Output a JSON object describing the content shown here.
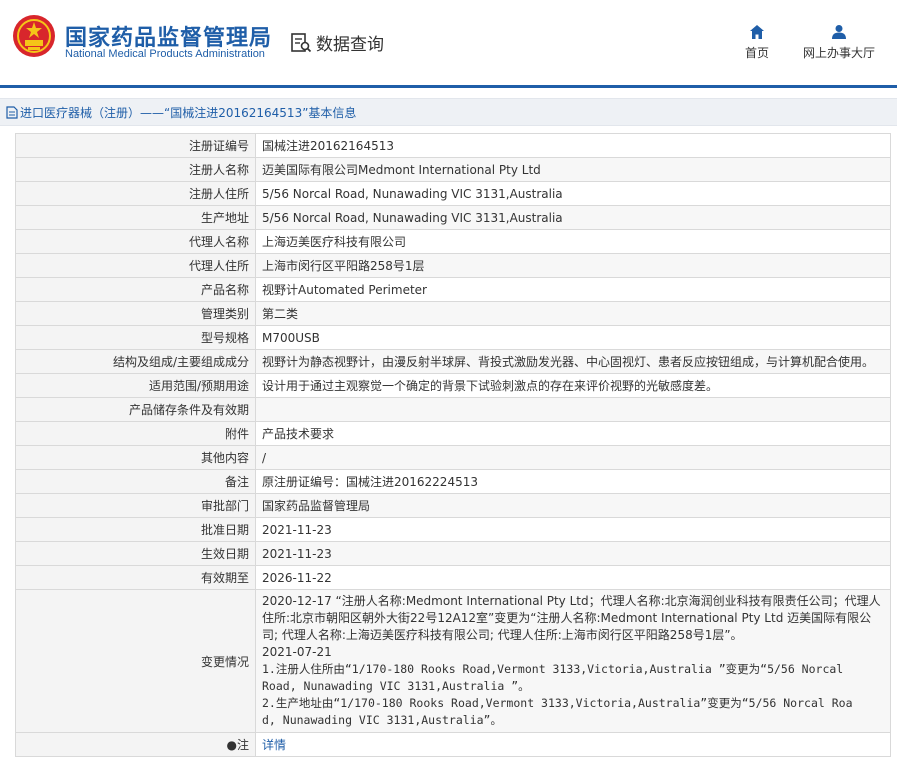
{
  "header": {
    "brand_cn": "国家药品监督管理局",
    "brand_en": "National Medical Products Administration",
    "query_label": "数据查询",
    "nav": [
      {
        "label": "首页",
        "icon": "home-icon"
      },
      {
        "label": "网上办事大厅",
        "icon": "user-icon"
      }
    ],
    "accent_color": "#1f5ea8"
  },
  "breadcrumb": "进口医疗器械（注册）——“国械注进20162164513”基本信息",
  "rows": [
    {
      "key": "注册证编号",
      "value": "国械注进20162164513"
    },
    {
      "key": "注册人名称",
      "value": "迈美国际有限公司Medmont International Pty Ltd"
    },
    {
      "key": "注册人住所",
      "value": "5/56 Norcal Road, Nunawading VIC 3131,Australia"
    },
    {
      "key": "生产地址",
      "value": "5/56 Norcal Road, Nunawading VIC 3131,Australia"
    },
    {
      "key": "代理人名称",
      "value": "上海迈美医疗科技有限公司"
    },
    {
      "key": "代理人住所",
      "value": "上海市闵行区平阳路258号1层"
    },
    {
      "key": "产品名称",
      "value": "视野计Automated Perimeter"
    },
    {
      "key": "管理类别",
      "value": "第二类"
    },
    {
      "key": "型号规格",
      "value": "M700USB"
    },
    {
      "key": "结构及组成/主要组成成分",
      "value": "视野计为静态视野计，由漫反射半球屏、背投式激励发光器、中心固视灯、患者反应按钮组成，与计算机配合使用。"
    },
    {
      "key": "适用范围/预期用途",
      "value": "设计用于通过主观察觉一个确定的背景下试验刺激点的存在来评价视野的光敏感度差。"
    },
    {
      "key": "产品储存条件及有效期",
      "value": ""
    },
    {
      "key": "附件",
      "value": "产品技术要求"
    },
    {
      "key": "其他内容",
      "value": "/"
    },
    {
      "key": "备注",
      "value": "原注册证编号：国械注进20162224513"
    },
    {
      "key": "审批部门",
      "value": "国家药品监督管理局"
    },
    {
      "key": "批准日期",
      "value": "2021-11-23"
    },
    {
      "key": "生效日期",
      "value": "2021-11-23"
    },
    {
      "key": "有效期至",
      "value": "2026-11-22"
    }
  ],
  "change": {
    "key": "变更情况",
    "lines": [
      "2020-12-17 “注册人名称:Medmont International Pty Ltd；代理人名称:北京海润创业科技有限责任公司；代理人",
      "住所:北京市朝阳区朝外大街22号12A12室”变更为“注册人名称:Medmont International Pty Ltd 迈美国际有限公",
      "司; 代理人名称:上海迈美医疗科技有限公司; 代理人住所:上海市闵行区平阳路258号1层”。",
      "2021-07-21",
      "1.注册人住所由“1/170-180 Rooks Road,Vermont 3133,Victoria,Australia ”变更为“5/56 Norcal",
      "Road, Nunawading VIC 3131,Australia ”。",
      "2.生产地址由“1/170-180 Rooks Road,Vermont 3133,Victoria,Australia”变更为“5/56 Norcal Roa",
      "d, Nunawading VIC 3131,Australia”。"
    ]
  },
  "note": {
    "key": "注",
    "icon": "pin-icon",
    "link": "详情"
  }
}
